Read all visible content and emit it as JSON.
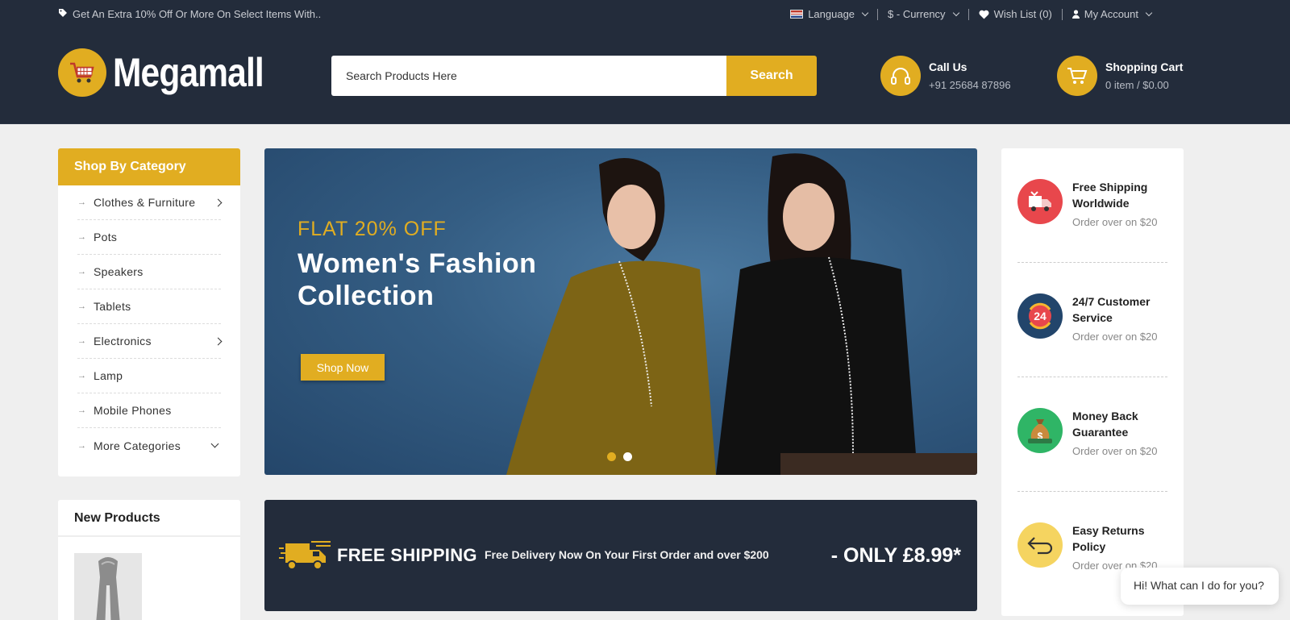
{
  "topbar": {
    "promo": "Get An Extra 10% Off Or More On Select Items With..",
    "language": "Language",
    "currency": "$ - Currency",
    "wishlist": "Wish List (0)",
    "account": "My Account"
  },
  "header": {
    "logo": "Megamall",
    "search_placeholder": "Search Products Here",
    "search_button": "Search",
    "call_title": "Call Us",
    "call_number": "+91 25684 87896",
    "cart_title": "Shopping Cart",
    "cart_summary": "0 item / $0.00"
  },
  "sidebar": {
    "title": "Shop By Category",
    "items": [
      {
        "label": "Clothes & Furniture",
        "has_sub": true
      },
      {
        "label": "Pots"
      },
      {
        "label": "Speakers"
      },
      {
        "label": "Tablets"
      },
      {
        "label": "Electronics",
        "has_sub": true
      },
      {
        "label": "Lamp"
      },
      {
        "label": "Mobile Phones"
      },
      {
        "label": "More Categories",
        "expand": true
      }
    ],
    "new_products_title": "New Products"
  },
  "banner": {
    "kicker": "FLAT 20% OFF",
    "headline_line1": "Women's Fashion",
    "headline_line2": "Collection",
    "button": "Shop Now",
    "slide_count": 2,
    "active_slide": 1
  },
  "shipping": {
    "title": "FREE SHIPPING",
    "description": "Free Delivery Now On Your First Order and over $200",
    "price": "- ONLY £8.99*"
  },
  "features": [
    {
      "title": "Free Shipping Worldwide",
      "sub": "Order over on $20",
      "icon": "delivery-truck-icon",
      "color": "#e8474c"
    },
    {
      "title": "24/7 Customer Service",
      "sub": "Order over on $20",
      "icon": "24-hours-icon",
      "color": "#22456b"
    },
    {
      "title": "Money Back Guarantee",
      "sub": "Order over on $20",
      "icon": "money-bag-icon",
      "color": "#2fb566"
    },
    {
      "title": "Easy Returns Policy",
      "sub": "Order over on $20",
      "icon": "return-arrow-icon",
      "color": "#f5d460"
    }
  ],
  "chat": {
    "message": "Hi! What can I do for you?"
  },
  "colors": {
    "accent": "#e1ad21",
    "dark": "#232c3b"
  }
}
